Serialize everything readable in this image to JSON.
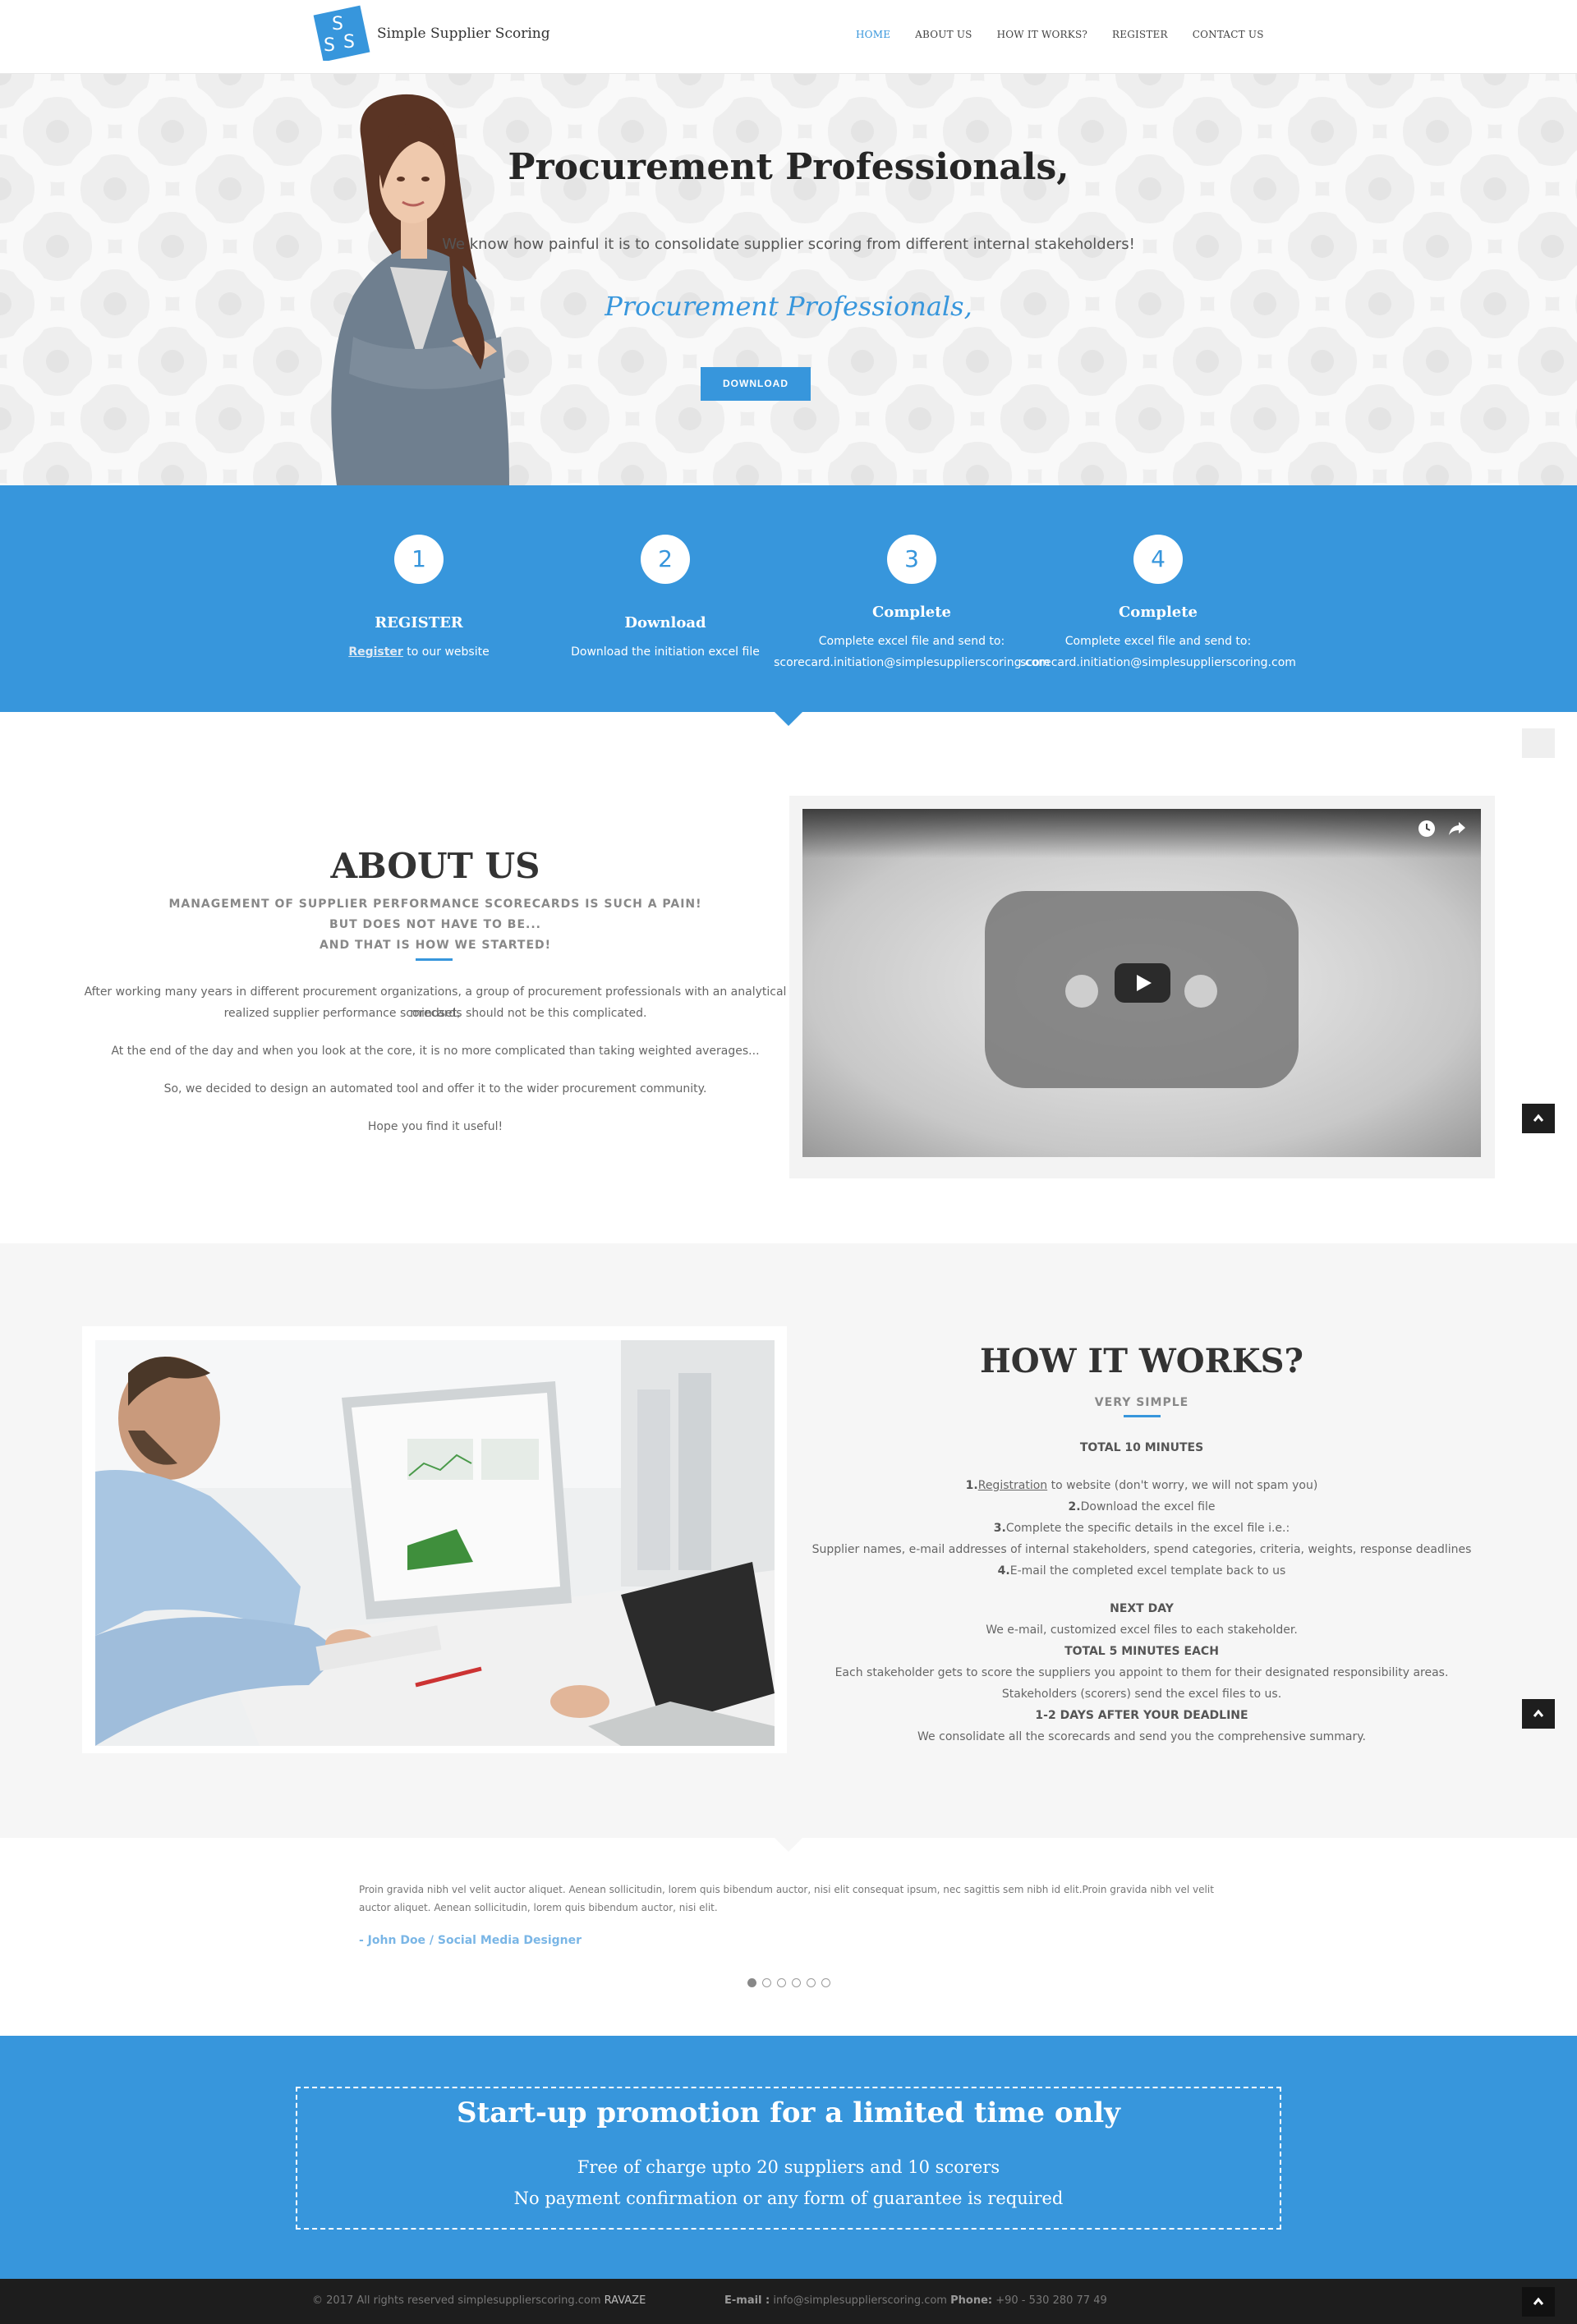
{
  "header": {
    "logo_letters": [
      "S",
      "S",
      "S"
    ],
    "brand": "Simple Supplier Scoring",
    "nav": [
      {
        "label": "HOME",
        "active": true
      },
      {
        "label": "ABOUT US",
        "active": false
      },
      {
        "label": "HOW IT WORKS?",
        "active": false
      },
      {
        "label": "REGISTER",
        "active": false
      },
      {
        "label": "CONTACT US",
        "active": false
      }
    ]
  },
  "hero": {
    "title": "Procurement Professionals,",
    "subtitle": "We know how painful it is to consolidate supplier scoring from different internal stakeholders!",
    "script": "Procurement Professionals,",
    "button": "DOWNLOAD"
  },
  "steps": [
    {
      "num": "1",
      "title": "REGISTER",
      "link": "Register",
      "text": " to our website"
    },
    {
      "num": "2",
      "title": "Download",
      "text": "Download the initiation excel file"
    },
    {
      "num": "3",
      "title": "Complete",
      "line1": "Complete  excel file  and send to:",
      "line2": "scorecard.initiation@simplesupplierscoring.com"
    },
    {
      "num": "4",
      "title": "Complete",
      "line1": "Complete  excel file  and send to:",
      "line2": "scorecard.initiation@simplesupplierscoring.com"
    }
  ],
  "about": {
    "title": "ABOUT US",
    "tag1": "MANAGEMENT OF SUPPLIER PERFORMANCE SCORECARDS IS SUCH A PAIN!",
    "tag2": "BUT DOES NOT HAVE TO BE...",
    "tag3": "AND THAT IS HOW WE STARTED!",
    "p1a": "After working many years in different procurement organizations, a group of procurement professionals with an analytical mindset,",
    "p1b": "realized supplier performance scorecards should not be this complicated.",
    "p2": "At the end of the day and when you look at the core, it is no more complicated than taking weighted averages...",
    "p3": "So, we decided to design an automated tool and offer it to the wider procurement community.",
    "p4": "Hope you find it useful!"
  },
  "how": {
    "title": "HOW IT WORKS?",
    "subtitle": "VERY SIMPLE",
    "total": "TOTAL 10 MINUTES",
    "s1_num": "1.",
    "s1_link": "Registration",
    "s1_text": " to website (don't worry, we will not spam you)",
    "s2_num": "2.",
    "s2_text": "Download the excel file",
    "s3_num": "3.",
    "s3_text": "Complete the specific details in the excel file i.e.:",
    "s3_detail": "Supplier names, e-mail addresses of internal stakeholders, spend categories, criteria, weights, response deadlines",
    "s4_num": "4.",
    "s4_text": "E-mail the completed excel template back to us",
    "next_day": "NEXT DAY",
    "next_day_text": "We e-mail, customized excel files to each stakeholder.",
    "total5": "TOTAL 5 MINUTES EACH",
    "total5_text1": "Each stakeholder gets to score the suppliers you appoint to them for their designated responsibility areas.",
    "total5_text2": "Stakeholders (scorers) send the excel files to us.",
    "deadline": "1-2 DAYS AFTER YOUR DEADLINE",
    "deadline_text": "We consolidate all the scorecards and send you the comprehensive summary."
  },
  "testimonial": {
    "text": "Proin gravida nibh vel velit auctor aliquet. Aenean sollicitudin, lorem quis bibendum auctor, nisi elit consequat ipsum, nec sagittis sem nibh id elit.Proin gravida nibh vel velit auctor aliquet. Aenean sollicitudin, lorem quis bibendum auctor, nisi elit.",
    "author": "- John Doe / Social Media Designer",
    "dots": 6,
    "active_dot": 0
  },
  "promo": {
    "title": "Start-up promotion for a limited time only",
    "line1": "Free of charge upto 20 suppliers and 10 scorers",
    "line2": "No payment confirmation or any form of guarantee is required"
  },
  "footer": {
    "copyright": "© 2017 All rights reserved simplesupplierscoring.com",
    "company": "RAVAZE",
    "email_label": "E-mail :",
    "email": "info@simplesupplierscoring.com",
    "phone_label": "Phone:",
    "phone": "+90 - 530 280 77 49"
  },
  "colors": {
    "accent": "#3796dc",
    "dark": "#1d1d1d",
    "heading": "#333333"
  },
  "icons": [
    "clock-icon",
    "share-icon",
    "play-icon",
    "chevron-up-icon"
  ]
}
